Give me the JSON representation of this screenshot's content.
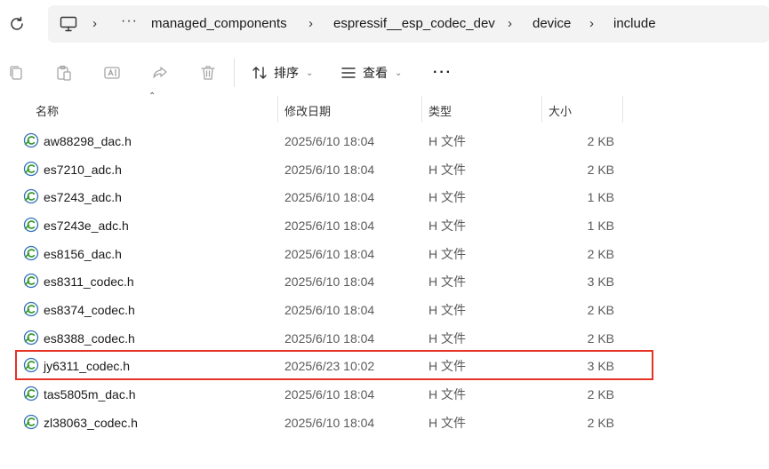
{
  "nav": {
    "breadcrumb": [
      "managed_components",
      "espressif__esp_codec_dev",
      "device",
      "include"
    ],
    "overflow": "···",
    "separator": "›"
  },
  "toolbar": {
    "sort_label": "排序",
    "view_label": "查看",
    "more_label": "···"
  },
  "columns": {
    "name": "名称",
    "date": "修改日期",
    "type": "类型",
    "size": "大小"
  },
  "files": [
    {
      "name": "aw88298_dac.h",
      "date": "2025/6/10 18:04",
      "type": "H 文件",
      "size": "2 KB"
    },
    {
      "name": "es7210_adc.h",
      "date": "2025/6/10 18:04",
      "type": "H 文件",
      "size": "2 KB"
    },
    {
      "name": "es7243_adc.h",
      "date": "2025/6/10 18:04",
      "type": "H 文件",
      "size": "1 KB"
    },
    {
      "name": "es7243e_adc.h",
      "date": "2025/6/10 18:04",
      "type": "H 文件",
      "size": "1 KB"
    },
    {
      "name": "es8156_dac.h",
      "date": "2025/6/10 18:04",
      "type": "H 文件",
      "size": "2 KB"
    },
    {
      "name": "es8311_codec.h",
      "date": "2025/6/10 18:04",
      "type": "H 文件",
      "size": "3 KB"
    },
    {
      "name": "es8374_codec.h",
      "date": "2025/6/10 18:04",
      "type": "H 文件",
      "size": "2 KB"
    },
    {
      "name": "es8388_codec.h",
      "date": "2025/6/10 18:04",
      "type": "H 文件",
      "size": "2 KB"
    },
    {
      "name": "jy6311_codec.h",
      "date": "2025/6/23 10:02",
      "type": "H 文件",
      "size": "3 KB"
    },
    {
      "name": "tas5805m_dac.h",
      "date": "2025/6/10 18:04",
      "type": "H 文件",
      "size": "2 KB"
    },
    {
      "name": "zl38063_codec.h",
      "date": "2025/6/10 18:04",
      "type": "H 文件",
      "size": "2 KB"
    }
  ],
  "colors": {
    "highlight_border": "#e53224",
    "file_icon_green": "#3a9a2c",
    "file_icon_blue": "#2f6fb8"
  }
}
